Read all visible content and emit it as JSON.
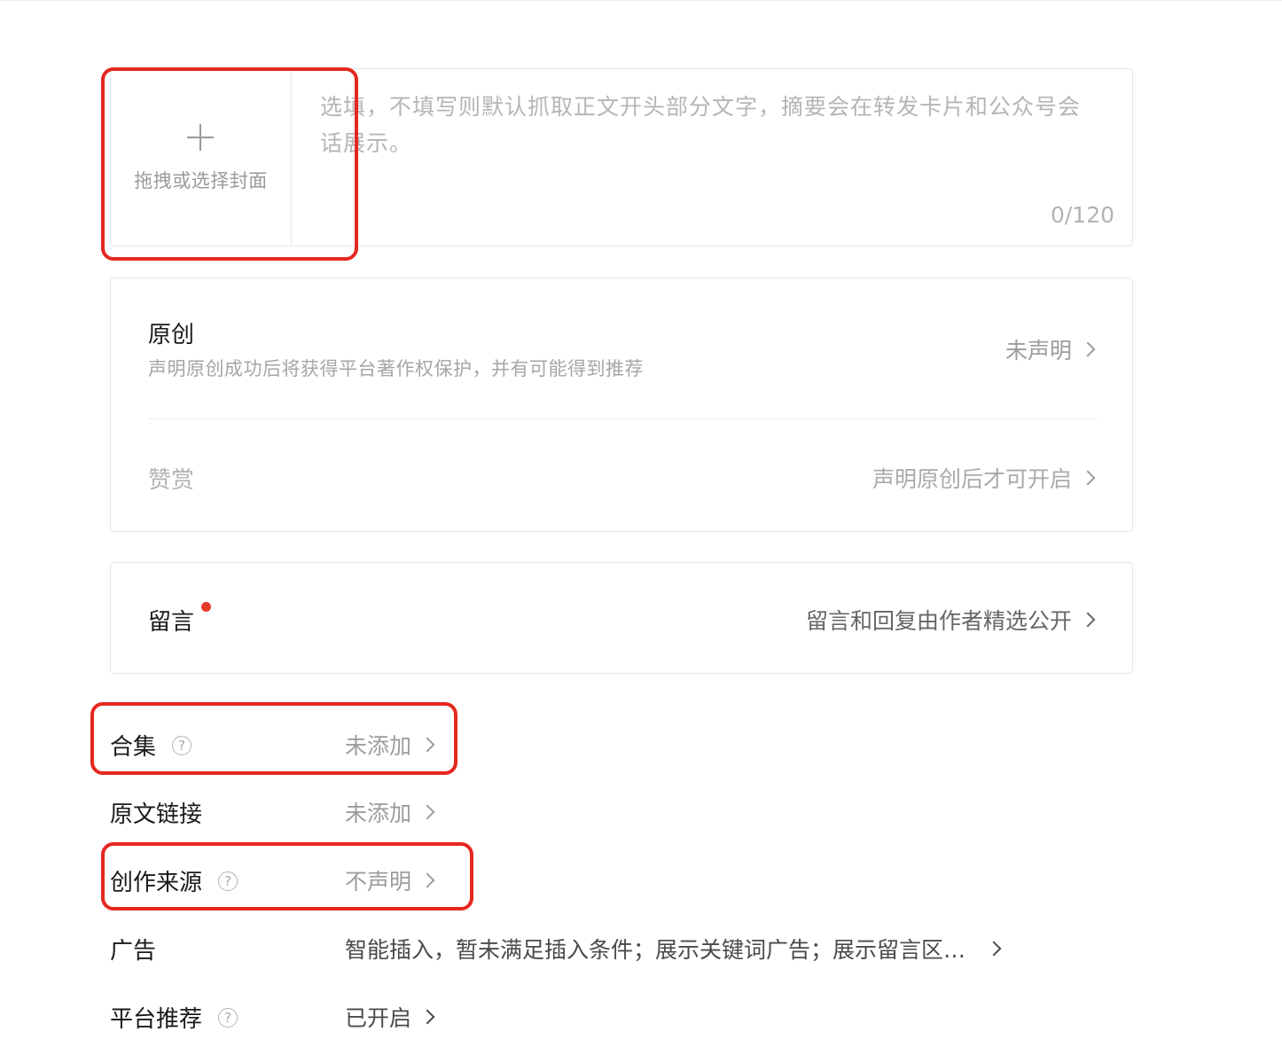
{
  "cover": {
    "label": "拖拽或选择封面",
    "summary_placeholder": "选填，不填写则默认抓取正文开头部分文字，摘要会在转发卡片和公众号会话展示。",
    "summary_count": "0/120"
  },
  "original": {
    "title": "原创",
    "description": "声明原创成功后将获得平台著作权保护，并有可能得到推荐",
    "value": "未声明",
    "reward_title": "赞赏",
    "reward_value": "声明原创后才可开启"
  },
  "comment": {
    "title": "留言",
    "value": "留言和回复由作者精选公开"
  },
  "settings": [
    {
      "label": "合集",
      "value": "未添加"
    },
    {
      "label": "原文链接",
      "value": "未添加"
    },
    {
      "label": "创作来源",
      "value": "不声明"
    },
    {
      "label": "广告",
      "value": "智能插入，暂未满足插入条件；展示关键词广告；展示留言区…"
    },
    {
      "label": "平台推荐",
      "value": "已开启"
    }
  ],
  "help_glyph": "?",
  "colors": {
    "highlight": "#e5281f",
    "notification_dot": "#e53b2a"
  }
}
